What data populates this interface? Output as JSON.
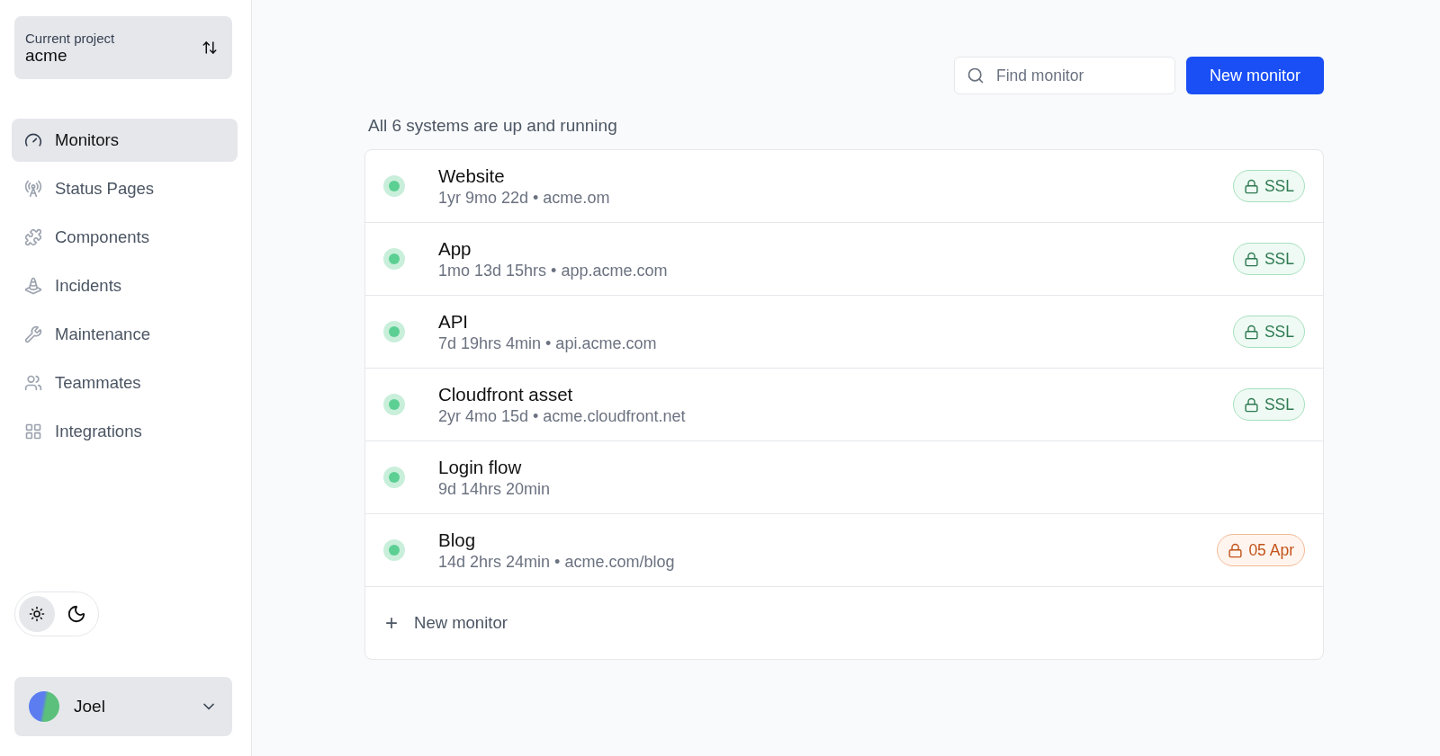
{
  "project": {
    "label": "Current project",
    "name": "acme"
  },
  "nav": [
    {
      "label": "Monitors",
      "selected": true
    },
    {
      "label": "Status Pages",
      "selected": false
    },
    {
      "label": "Components",
      "selected": false
    },
    {
      "label": "Incidents",
      "selected": false
    },
    {
      "label": "Maintenance",
      "selected": false
    },
    {
      "label": "Teammates",
      "selected": false
    },
    {
      "label": "Integrations",
      "selected": false
    }
  ],
  "theme_toggle": [
    {
      "selected": true
    },
    {
      "selected": false
    }
  ],
  "user": {
    "name": "Joel"
  },
  "search": {
    "placeholder": "Find monitor"
  },
  "new_button": "New monitor",
  "summary": "All 6 systems are up and running",
  "monitors": [
    {
      "name": "Website",
      "detail": "1yr 9mo 22d • acme.om",
      "badge": {
        "kind": "ok",
        "text": "SSL"
      }
    },
    {
      "name": "App",
      "detail": "1mo 13d 15hrs • app.acme.com",
      "badge": {
        "kind": "ok",
        "text": "SSL"
      }
    },
    {
      "name": "API",
      "detail": "7d 19hrs 4min • api.acme.com",
      "badge": {
        "kind": "ok",
        "text": "SSL"
      }
    },
    {
      "name": "Cloudfront asset",
      "detail": "2yr 4mo 15d • acme.cloudfront.net",
      "badge": {
        "kind": "ok",
        "text": "SSL"
      }
    },
    {
      "name": "Login flow",
      "detail": "9d 14hrs 20min"
    },
    {
      "name": "Blog",
      "detail": "14d 2hrs 24min • acme.com/blog",
      "badge": {
        "kind": "warning",
        "text": "05 Apr"
      }
    }
  ],
  "add_row": {
    "icon": "+",
    "label": "New monitor"
  }
}
